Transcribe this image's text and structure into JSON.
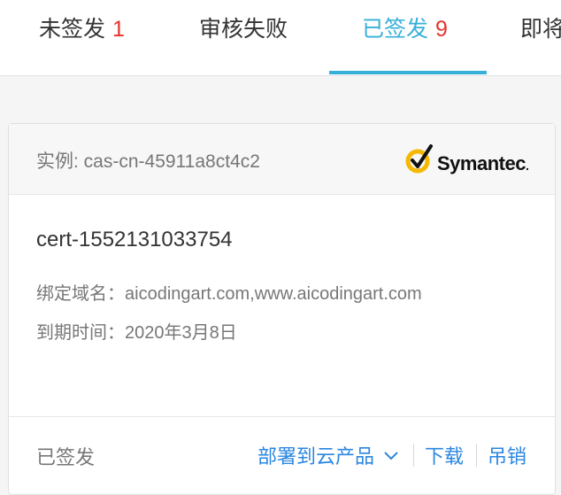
{
  "tabs": [
    {
      "label": "未签发",
      "count": "1",
      "active": false
    },
    {
      "label": "审核失败",
      "count": "",
      "active": false
    },
    {
      "label": "已签发",
      "count": "9",
      "active": true
    },
    {
      "label": "即将",
      "count": "",
      "active": false
    }
  ],
  "card": {
    "instance": "实例: cas-cn-45911a8ct4c2",
    "brand": {
      "name": "Symantec",
      "suffix": "."
    },
    "cert_name": "cert-1552131033754",
    "domains_label": "绑定域名：",
    "domains_value": "aicodingart.com,www.aicodingart.com",
    "expiry_label": "到期时间：",
    "expiry_value": "2020年3月8日",
    "status": "已签发",
    "actions": {
      "deploy": "部署到云产品",
      "download": "下载",
      "revoke": "吊销"
    }
  },
  "colors": {
    "accent": "#36b0d9",
    "link": "#2a86e0",
    "count": "#e5332c",
    "brand_yellow": "#f5b800"
  },
  "icons": {
    "deploy_dropdown": "chevron-down-icon",
    "brand": "checkmark-circle-icon"
  }
}
